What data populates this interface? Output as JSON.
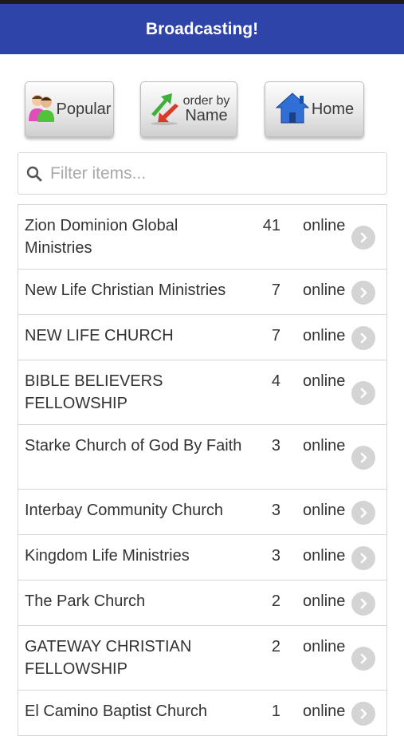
{
  "header": {
    "title": "Broadcasting!"
  },
  "buttons": {
    "popular": "Popular",
    "order_line1": "order by",
    "order_line2": "Name",
    "home": "Home"
  },
  "search": {
    "placeholder": "Filter items...",
    "value": ""
  },
  "items": [
    {
      "name": "Zion Dominion Global Ministries",
      "count": "41",
      "status": "online"
    },
    {
      "name": "New Life Christian Ministries",
      "count": "7",
      "status": "online"
    },
    {
      "name": "NEW LIFE CHURCH",
      "count": "7",
      "status": "online"
    },
    {
      "name": "BIBLE BELIEVERS FELLOWSHIP",
      "count": "4",
      "status": "online"
    },
    {
      "name": "Starke Church of God By Faith",
      "count": "3",
      "status": "online"
    },
    {
      "name": "Interbay Community Church",
      "count": "3",
      "status": "online"
    },
    {
      "name": "Kingdom Life Ministries",
      "count": "3",
      "status": "online"
    },
    {
      "name": "The Park Church",
      "count": "2",
      "status": "online"
    },
    {
      "name": "GATEWAY CHRISTIAN FELLOWSHIP",
      "count": "2",
      "status": "online"
    },
    {
      "name": "El Camino Baptist Church",
      "count": "1",
      "status": "online"
    }
  ],
  "icons": {
    "popular": "people-icon",
    "order": "sort-arrows-icon",
    "home": "house-icon",
    "search": "search-icon",
    "row": "chevron-right-icon"
  },
  "colors": {
    "header_bg": "#2f44a8",
    "header_text": "#ffffff",
    "arrow_bg": "#d4d4d4"
  }
}
